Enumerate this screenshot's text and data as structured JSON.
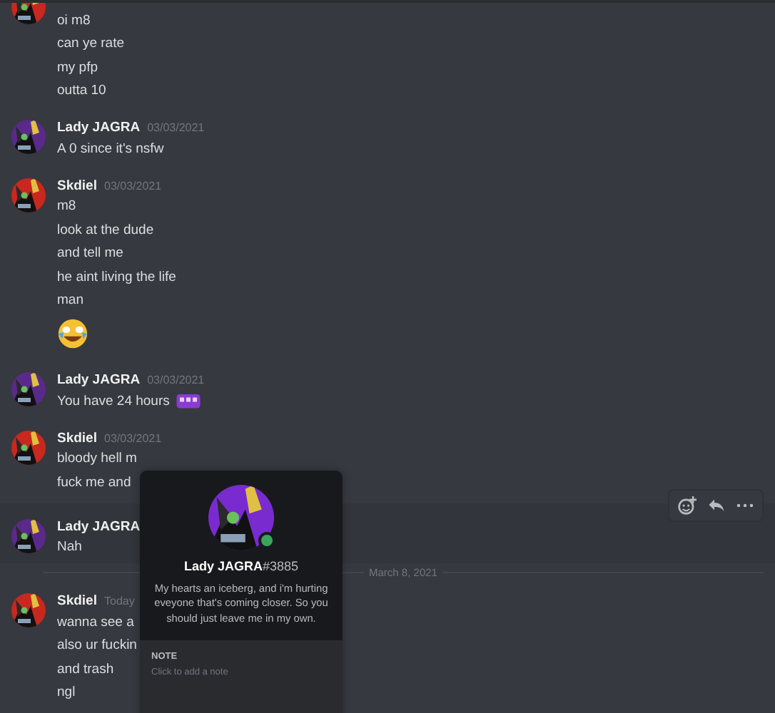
{
  "feed": [
    {
      "kind": "group",
      "continued": true,
      "color": "#c8281e",
      "hovered": false,
      "lines": [
        {
          "kind": "text",
          "text": "oi m8"
        },
        {
          "kind": "text",
          "text": "can ye rate"
        },
        {
          "kind": "text",
          "text": "my pfp"
        },
        {
          "kind": "text",
          "text": "outta 10"
        }
      ]
    },
    {
      "kind": "group",
      "continued": false,
      "author": "Lady JAGRA",
      "timestamp": "03/03/2021",
      "color": "#5a2a8a",
      "hovered": false,
      "lines": [
        {
          "kind": "text",
          "text": "A 0 since it's nsfw"
        }
      ]
    },
    {
      "kind": "group",
      "continued": false,
      "author": "Skdiel",
      "timestamp": "03/03/2021",
      "color": "#c8281e",
      "hovered": false,
      "lines": [
        {
          "kind": "text",
          "text": "m8"
        },
        {
          "kind": "text",
          "text": "look at the dude"
        },
        {
          "kind": "text",
          "text": "and tell me"
        },
        {
          "kind": "text",
          "text": "he aint living the life"
        },
        {
          "kind": "text",
          "text": "man"
        },
        {
          "kind": "emoji"
        }
      ]
    },
    {
      "kind": "group",
      "continued": false,
      "author": "Lady JAGRA",
      "timestamp": "03/03/2021",
      "color": "#5a2a8a",
      "hovered": false,
      "lines": [
        {
          "kind": "text",
          "text": "You have 24 hours",
          "emoji": true
        }
      ]
    },
    {
      "kind": "group",
      "continued": false,
      "author": "Skdiel",
      "timestamp": "03/03/2021",
      "color": "#c8281e",
      "hovered": false,
      "lines": [
        {
          "kind": "text",
          "text": "bloody hell m"
        },
        {
          "kind": "text",
          "text": "fuck me and"
        }
      ]
    },
    {
      "kind": "group",
      "continued": false,
      "author": "Lady JAGRA",
      "color": "#5a2a8a",
      "hovered": true,
      "lines": [
        {
          "kind": "text",
          "text": "Nah"
        }
      ]
    },
    {
      "kind": "divider",
      "label": "March 8, 2021"
    },
    {
      "kind": "group",
      "continued": false,
      "author": "Skdiel",
      "timestamp": "Today",
      "color": "#c8281e",
      "hovered": false,
      "lines": [
        {
          "kind": "text",
          "text": "wanna see a"
        },
        {
          "kind": "text",
          "text": "also ur fuckin"
        },
        {
          "kind": "text",
          "text": "and trash"
        },
        {
          "kind": "text",
          "text": "ngl"
        }
      ]
    }
  ],
  "toolbar": [
    {
      "kind": "reaction"
    },
    {
      "kind": "reply"
    },
    {
      "kind": "more"
    }
  ],
  "popup": {
    "username": "Lady JAGRA",
    "discriminator": "#3885",
    "online": true,
    "bio": "My hearts an iceberg, and i'm hurting eveyone that's coming closer. So you should just leave me in my own.",
    "note_label": "NOTE",
    "note_placeholder": "Click to add a note"
  }
}
